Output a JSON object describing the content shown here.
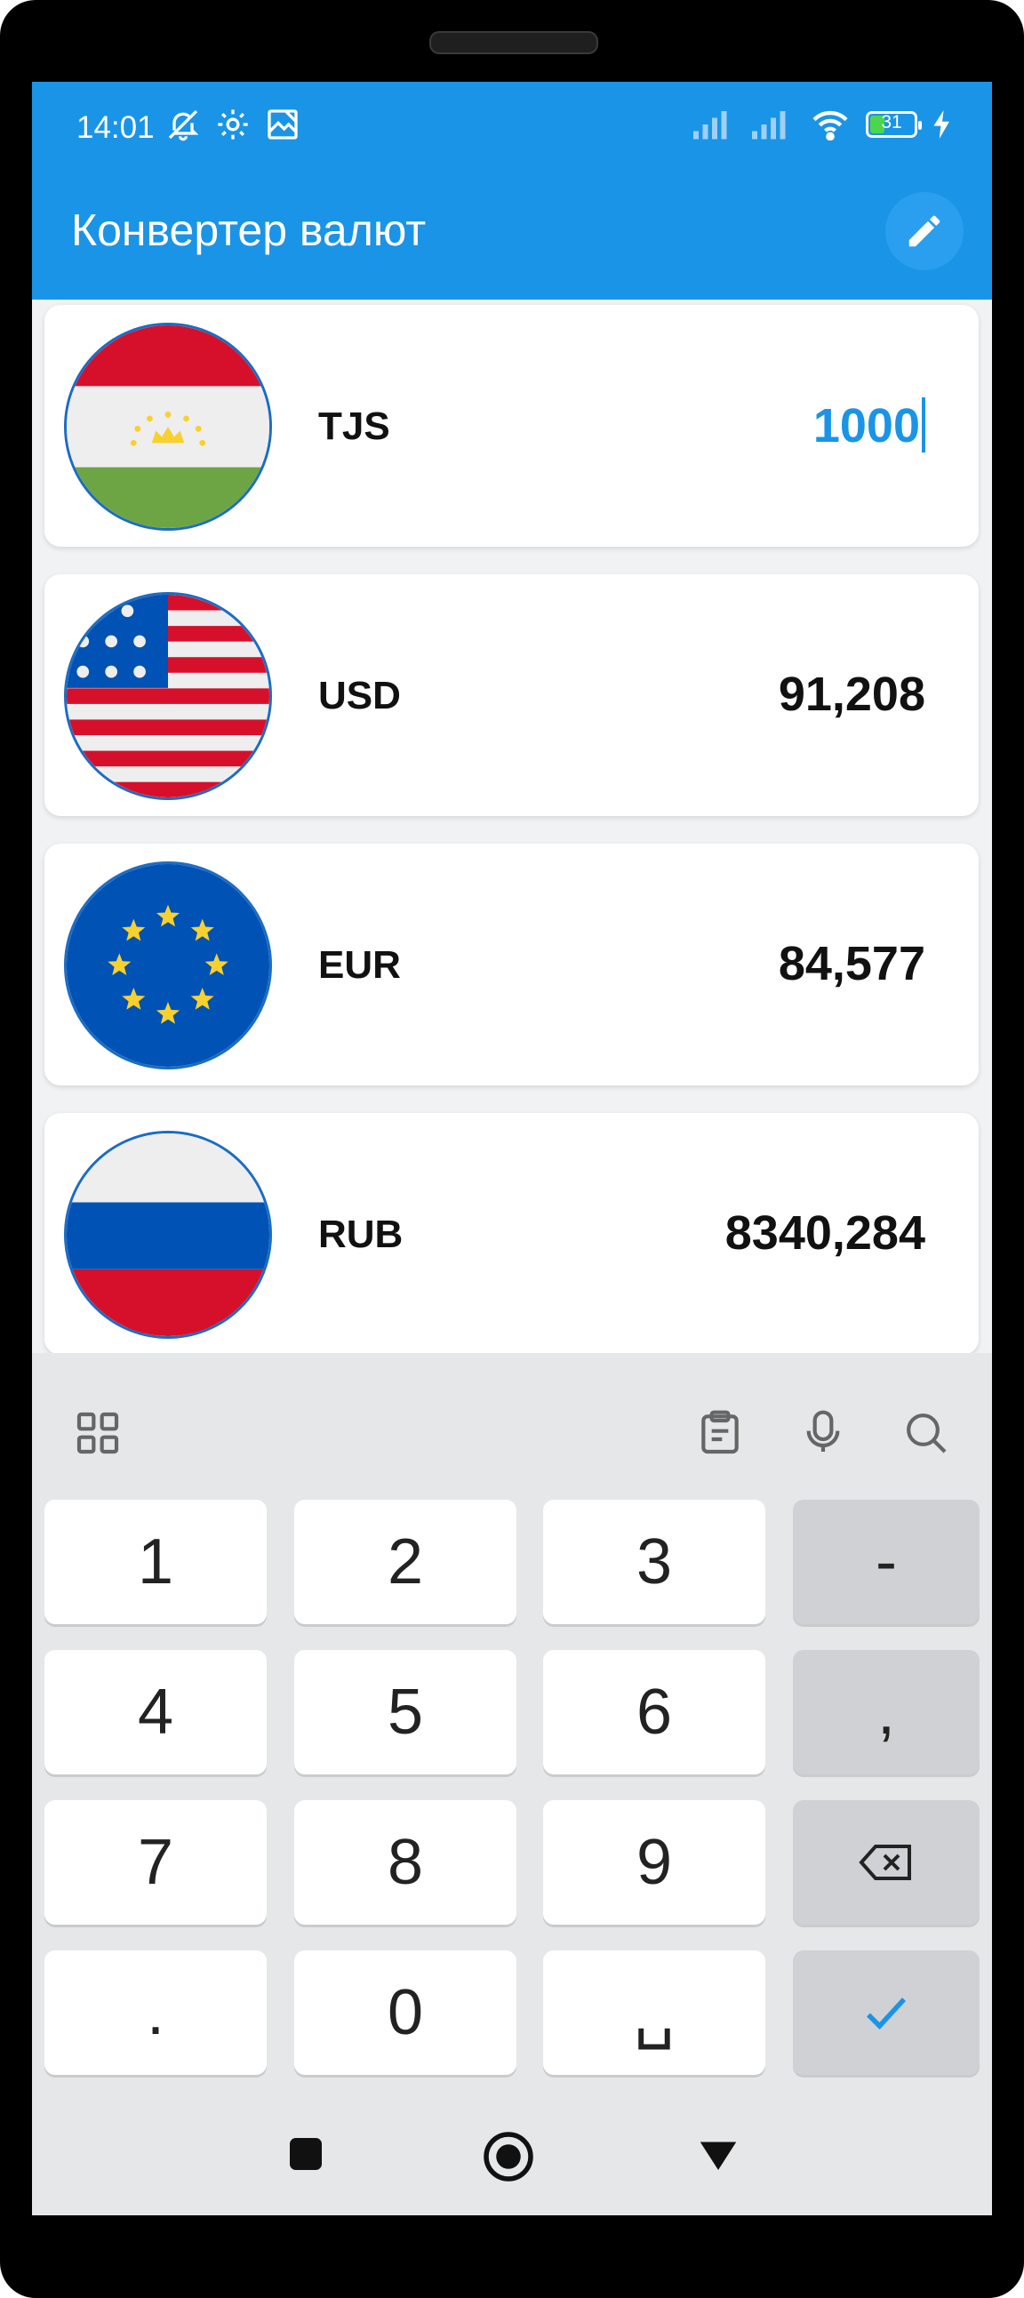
{
  "status_bar": {
    "time": "14:01",
    "battery_percent": "31",
    "battery_level": 0.31
  },
  "app_bar": {
    "title": "Конвертер валют",
    "edit_icon": "pencil-icon"
  },
  "currencies": [
    {
      "code": "TJS",
      "amount": "1000",
      "active": true,
      "flag": "tajikistan-flag"
    },
    {
      "code": "USD",
      "amount": "91,208",
      "active": false,
      "flag": "usa-flag"
    },
    {
      "code": "EUR",
      "amount": "84,577",
      "active": false,
      "flag": "eu-flag"
    },
    {
      "code": "RUB",
      "amount": "8340,284",
      "active": false,
      "flag": "russia-flag"
    }
  ],
  "keyboard": {
    "toolbar": [
      "grid-icon",
      "clipboard-icon",
      "microphone-icon",
      "search-icon"
    ],
    "keys": [
      [
        "1",
        "2",
        "3",
        "-"
      ],
      [
        "4",
        "5",
        "6",
        ","
      ],
      [
        "7",
        "8",
        "9",
        "backspace-icon"
      ],
      [
        ".",
        "0",
        "␣",
        "check-icon"
      ]
    ]
  },
  "colors": {
    "primary": "#1a94e6",
    "keyboard_bg": "#e6e7e9",
    "func_key": "#cfd1d5"
  }
}
